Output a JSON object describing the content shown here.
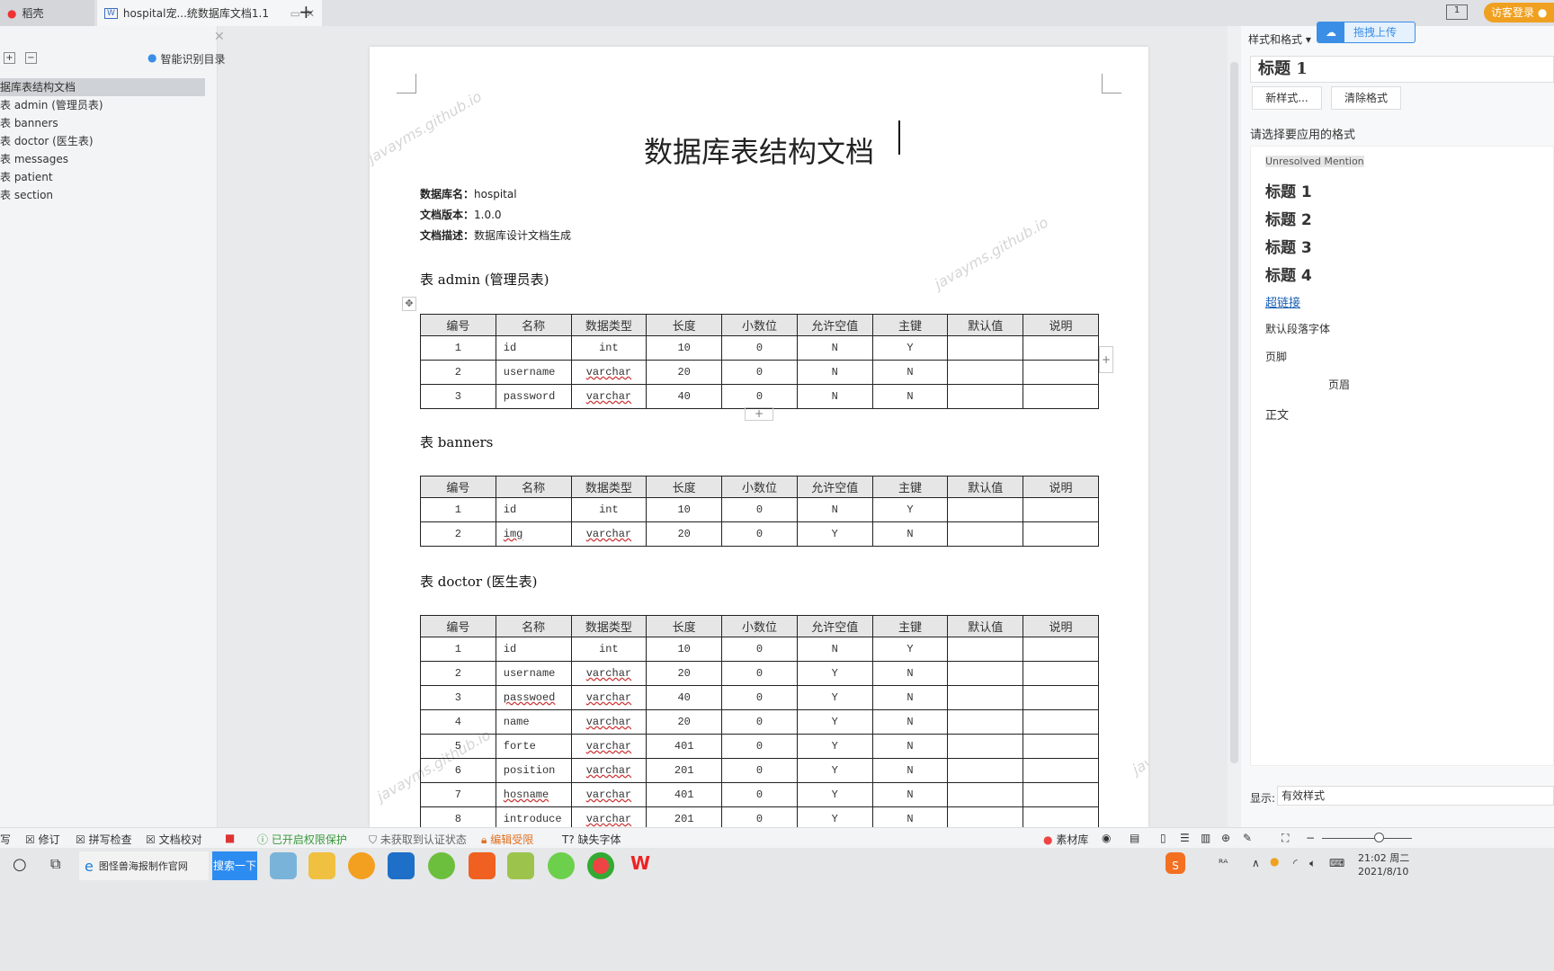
{
  "tabs": [
    {
      "label": "稻壳"
    },
    {
      "label": "hospital宠...统数据库文档1.1"
    }
  ],
  "left_panel": {
    "smart_toc": "智能识别目录",
    "items": [
      "据库表结构文档",
      "表 admin (管理员表)",
      "表 banners",
      "表 doctor (医生表)",
      "表 messages",
      "表 patient",
      "表 section"
    ]
  },
  "document": {
    "title": "数据库表结构文档",
    "meta": [
      {
        "k": "数据库名：",
        "v": "hospital"
      },
      {
        "k": "文档版本：",
        "v": "1.0.0"
      },
      {
        "k": "文档描述：",
        "v": "数据库设计文档生成"
      }
    ],
    "watermark": "javayms.github.io",
    "columns": [
      "编号",
      "名称",
      "数据类型",
      "长度",
      "小数位",
      "允许空值",
      "主键",
      "默认值",
      "说明"
    ],
    "tables": [
      {
        "heading": "表 admin (管理员表)",
        "rows": [
          [
            "1",
            "id",
            "int",
            "10",
            "0",
            "N",
            "Y",
            "",
            ""
          ],
          [
            "2",
            "username",
            "varchar",
            "20",
            "0",
            "N",
            "N",
            "",
            ""
          ],
          [
            "3",
            "password",
            "varchar",
            "40",
            "0",
            "N",
            "N",
            "",
            ""
          ]
        ]
      },
      {
        "heading": "表 banners",
        "rows": [
          [
            "1",
            "id",
            "int",
            "10",
            "0",
            "N",
            "Y",
            "",
            ""
          ],
          [
            "2",
            "img",
            "varchar",
            "20",
            "0",
            "Y",
            "N",
            "",
            ""
          ]
        ]
      },
      {
        "heading": "表 doctor (医生表)",
        "rows": [
          [
            "1",
            "id",
            "int",
            "10",
            "0",
            "N",
            "Y",
            "",
            ""
          ],
          [
            "2",
            "username",
            "varchar",
            "20",
            "0",
            "Y",
            "N",
            "",
            ""
          ],
          [
            "3",
            "passwoed",
            "varchar",
            "40",
            "0",
            "Y",
            "N",
            "",
            ""
          ],
          [
            "4",
            "name",
            "varchar",
            "20",
            "0",
            "Y",
            "N",
            "",
            ""
          ],
          [
            "5",
            "forte",
            "varchar",
            "401",
            "0",
            "Y",
            "N",
            "",
            ""
          ],
          [
            "6",
            "position",
            "varchar",
            "201",
            "0",
            "Y",
            "N",
            "",
            ""
          ],
          [
            "7",
            "hosname",
            "varchar",
            "401",
            "0",
            "Y",
            "N",
            "",
            ""
          ],
          [
            "8",
            "introduce",
            "varchar",
            "201",
            "0",
            "Y",
            "N",
            "",
            ""
          ]
        ]
      }
    ]
  },
  "right_panel": {
    "header": "样式和格式 ▾",
    "upload": "拖拽上传",
    "current_style": "标题 1",
    "new_style": "新样式...",
    "clear_format": "清除格式",
    "prompt": "请选择要应用的格式",
    "styles": [
      "Unresolved Mention",
      "标题 1",
      "标题 2",
      "标题 3",
      "标题 4",
      "超链接",
      "默认段落字体",
      "页脚",
      "页眉",
      "正文"
    ],
    "show_label": "显示:",
    "show_value": "有效样式"
  },
  "topright": {
    "login": "访客登录"
  },
  "status": {
    "items": [
      "写",
      "修订",
      "拼写检查",
      "文档校对",
      "已开启权限保护",
      "未获取到认证状态",
      "编辑受限",
      "缺失字体"
    ],
    "material": "素材库"
  },
  "taskbar": {
    "search_text": "图怪兽海报制作官网",
    "search_btn": "搜索一下",
    "time": "21:02 周二",
    "date": "2021/8/10"
  }
}
